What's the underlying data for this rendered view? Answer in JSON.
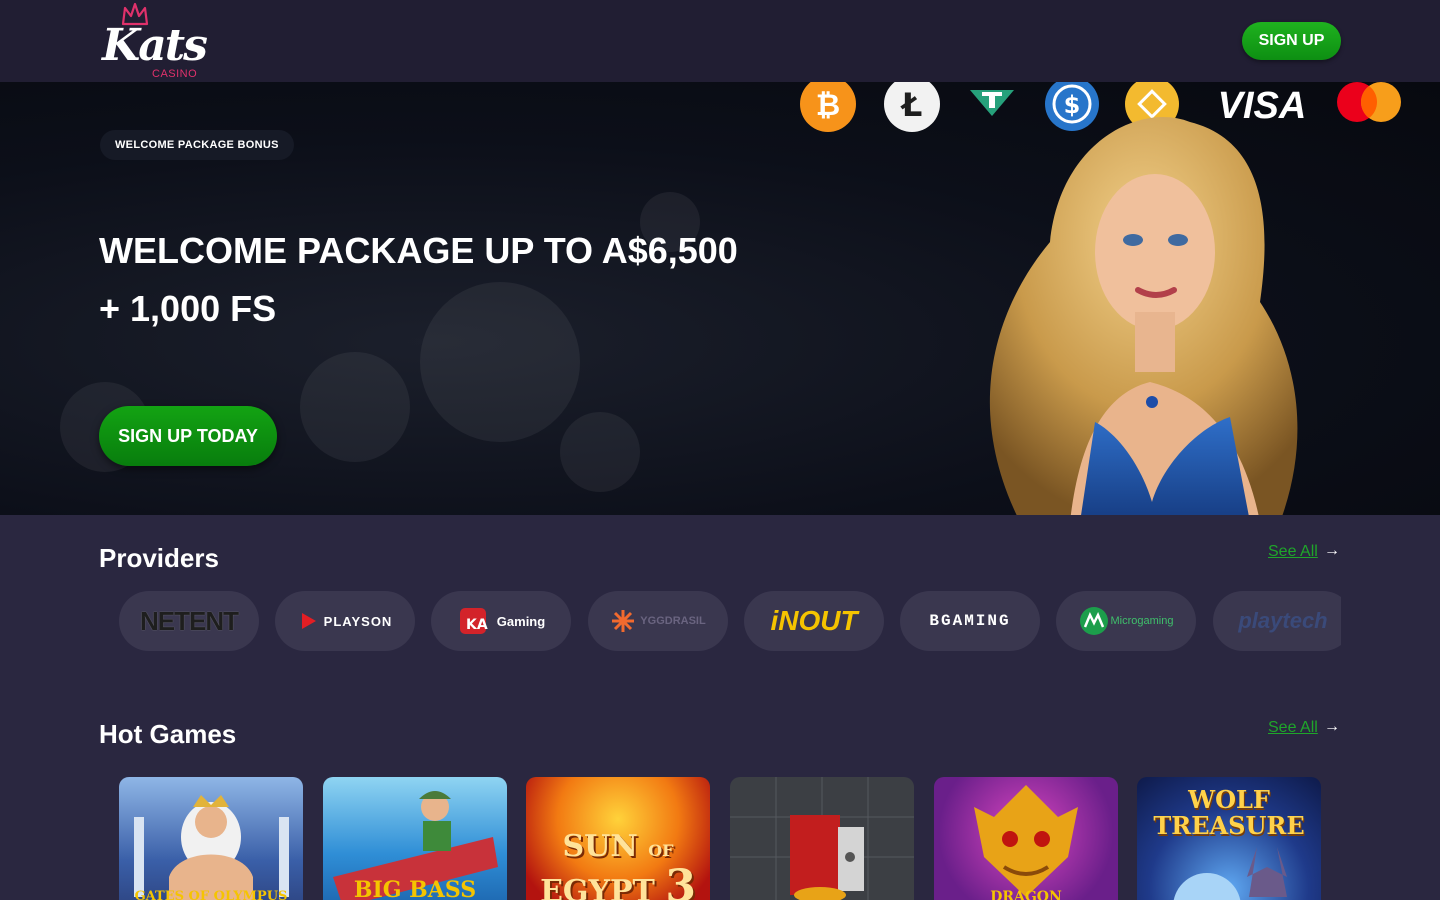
{
  "header": {
    "logo_text": "Kats",
    "logo_sub": "CASINO",
    "signup_label": "SIGN UP"
  },
  "hero": {
    "badge": "WELCOME PACKAGE BONUS",
    "title_line1": "WELCOME PACKAGE UP TO A$6,500",
    "title_line2": "+ 1,000 FS",
    "cta_label": "SIGN UP TODAY",
    "payment_methods": [
      "bitcoin-icon",
      "litecoin-icon",
      "tether-icon",
      "usdc-icon",
      "binance-icon",
      "visa-logo",
      "mastercard-logo"
    ],
    "visa_text": "VISA"
  },
  "providers": {
    "title": "Providers",
    "see_all": "See All",
    "items": [
      "NETENT",
      "PLAYSON",
      "Gaming",
      "YGGDRASIL",
      "iNOUT",
      "BGAMING",
      "Microgaming",
      "playtech"
    ]
  },
  "hot_games": {
    "title": "Hot Games",
    "see_all": "See All",
    "items": [
      "GATES OF OLYMPUS",
      "BIG BASS",
      "SUN OF EGYPT 3",
      "",
      "DRAGON",
      "WOLF TREASURE"
    ],
    "sun_word": "SUN",
    "of_word": "OF",
    "egypt_word": "EGYPT",
    "egypt_num": "3",
    "wolf_line1": "WOLF",
    "wolf_line2": "TREASURE"
  },
  "colors": {
    "accent_green": "#13a313",
    "link_green": "#1fa62a",
    "header_bg": "#211e33",
    "page_bg": "#2a2740"
  }
}
